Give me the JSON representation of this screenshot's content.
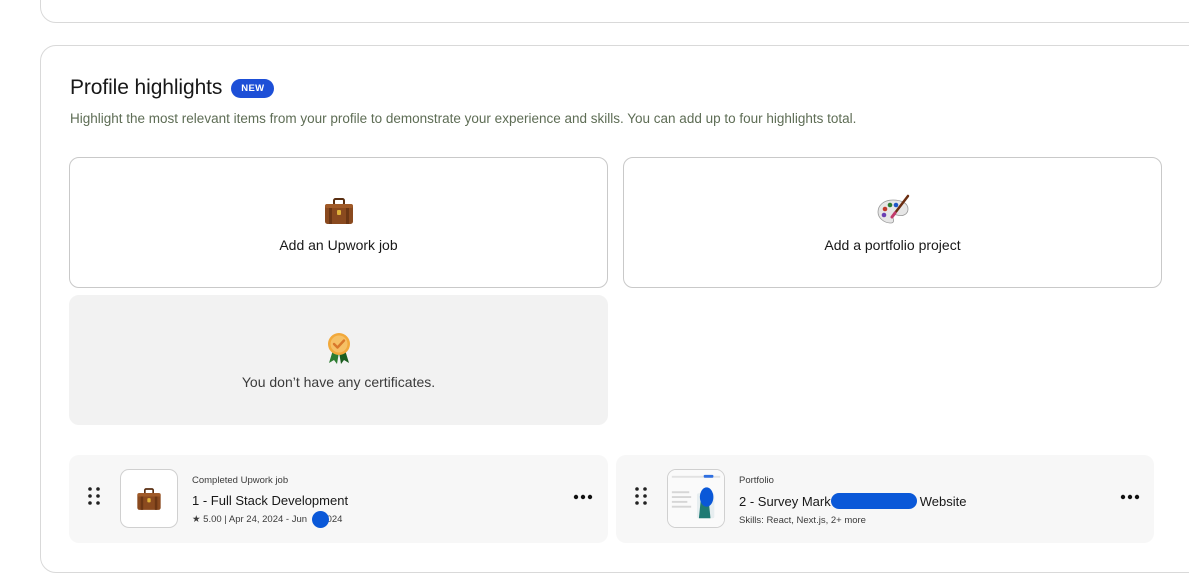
{
  "section": {
    "title": "Profile highlights",
    "badge": "NEW",
    "subtitle": "Highlight the most relevant items from your profile to demonstrate your experience and skills. You can add up to four highlights total."
  },
  "tiles": {
    "upwork_job": {
      "label": "Add an Upwork job",
      "icon": "briefcase-icon"
    },
    "portfolio": {
      "label": "Add a portfolio project",
      "icon": "palette-icon"
    },
    "certificates": {
      "label": "You don’t have any certificates.",
      "icon": "medal-icon"
    }
  },
  "highlights": [
    {
      "kind": "Completed Upwork job",
      "title": "1 - Full Stack Development",
      "meta": "★ 5.00 | Apr 24, 2024 - Jun",
      "meta_tail": ", 2024",
      "icon": "briefcase-icon"
    },
    {
      "kind": "Portfolio",
      "title": "2 - Survey Mark",
      "title_tail": "Website",
      "meta": "Skills: React, Next.js, 2+ more",
      "icon": "portfolio-thumbnail"
    }
  ],
  "colors": {
    "badge": "#1d4fd7",
    "redaction": "#0a58d8",
    "card_border": "#d9d9d9",
    "disabled_tile": "#f2f2f2"
  }
}
